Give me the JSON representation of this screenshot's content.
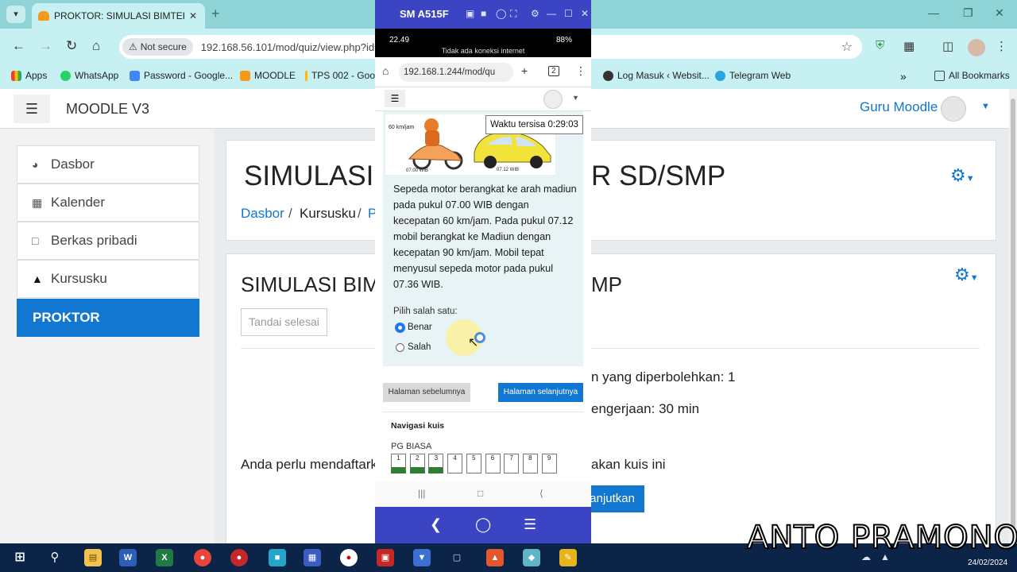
{
  "browser": {
    "tab_title": "PROKTOR: SIMULASI BIMTEK P",
    "not_secure": "Not secure",
    "url": "192.168.56.101/mod/quiz/view.php?id=",
    "bookmarks": [
      "Apps",
      "WhatsApp",
      "Password - Google...",
      "MOODLE",
      "TPS 002 - Goo",
      "Log Masuk ‹ Websit...",
      "Telegram Web"
    ],
    "all_bookmarks": "All Bookmarks"
  },
  "moodle": {
    "site_name": "MOODLE V3",
    "user_name": "Guru Moodle",
    "sidebar": [
      {
        "label": "Dasbor",
        "icon": "dashboard-icon"
      },
      {
        "label": "Kalender",
        "icon": "calendar-icon"
      },
      {
        "label": "Berkas pribadi",
        "icon": "file-icon"
      },
      {
        "label": "Kursusku",
        "icon": "graduation-cap-icon"
      },
      {
        "label": "PROKTOR",
        "icon": ""
      }
    ],
    "heading_left": "SIMULASI",
    "heading_right": "R SD/SMP",
    "breadcrumb": [
      "Dasbor",
      "/",
      "Kursusku",
      "/",
      "P"
    ],
    "quiz_title_left": "SIMULASI BIM",
    "quiz_title_right": "MP",
    "mark_done": "Tandai selesai",
    "info_attempts": "n yang diperbolehkan: 1",
    "info_time": "engerjaan: 30 min",
    "info_enrol_left": "Anda perlu mendaftark",
    "info_enrol_right": "akan kuis ini",
    "continue_button": "anjutkan"
  },
  "phone": {
    "device_name": "SM A515F",
    "time": "22.49",
    "battery": "88%",
    "network": "Tidak ada koneksi internet",
    "url": "192.168.1.244/mod/qu",
    "tab_count": "2",
    "timer": "Waktu tersisa 0:29:03",
    "illustration": {
      "speed": "60 km/jam",
      "time1": "07.00 WIB",
      "time2": "07.12 WIB"
    },
    "question": "Sepeda motor berangkat ke arah madiun pada pukul 07.00 WIB dengan kecepatan 60 km/jam. Pada pukul 07.12 mobil berangkat ke Madiun dengan kecepatan 90 km/jam. Mobil tepat menyusul sepeda motor pada pukul 07.36 WIB.",
    "choose_one": "Pilih salah satu:",
    "options": [
      "Benar",
      "Salah"
    ],
    "selected": "Benar",
    "prev_page": "Halaman sebelumnya",
    "next_page": "Halaman selanjutnya",
    "nav_title": "Navigasi kuis",
    "nav_section": "PG BIASA",
    "nav_numbers": [
      "1",
      "2",
      "3",
      "4",
      "5",
      "6",
      "7",
      "8",
      "9"
    ],
    "answered": [
      "1",
      "2",
      "3"
    ]
  },
  "taskbar": {
    "date": "24/02/2024"
  },
  "watermark": "ANTO PRAMONO"
}
